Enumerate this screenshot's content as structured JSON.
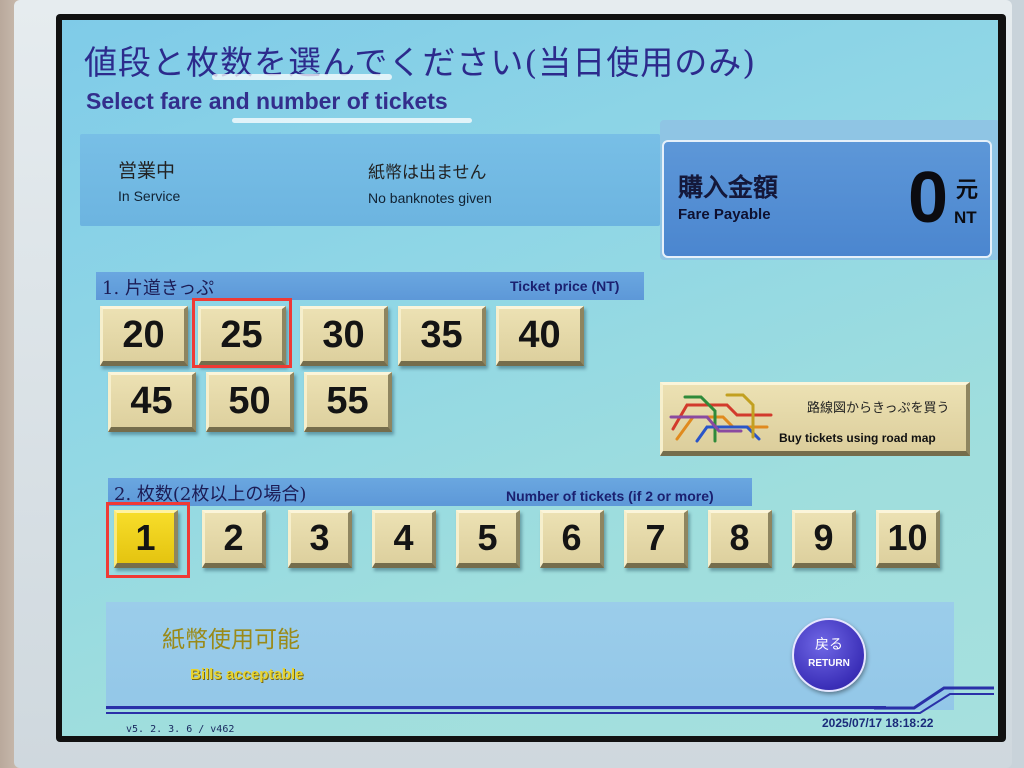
{
  "header": {
    "title_jp": "値段と枚数を選んでください(当日使用のみ)",
    "title_en": "Select fare and number of tickets"
  },
  "status": {
    "service_jp": "営業中",
    "service_en": "In Service",
    "notes_jp": "紙幣は出ません",
    "notes_en": "No banknotes given"
  },
  "fare": {
    "label_jp": "購入金額",
    "label_en": "Fare Payable",
    "amount": "0",
    "unit_jp": "元",
    "unit_en": "NT"
  },
  "ticket_price": {
    "section_jp": "1.  片道きっぷ",
    "section_en": "Ticket price (NT)",
    "options": [
      "20",
      "25",
      "30",
      "35",
      "40",
      "45",
      "50",
      "55"
    ],
    "highlighted": "25"
  },
  "route_map": {
    "label_jp": "路線図からきっぷを買う",
    "label_en": "Buy tickets using road map",
    "line_colors": [
      "#d23a2c",
      "#e08a1e",
      "#2f8a3a",
      "#2a55c8",
      "#c2a020",
      "#8a4aa0"
    ]
  },
  "ticket_count": {
    "section_jp": "2.  枚数(2枚以上の場合)",
    "section_en": "Number of tickets (if 2 or more)",
    "options": [
      "1",
      "2",
      "3",
      "4",
      "5",
      "6",
      "7",
      "8",
      "9",
      "10"
    ],
    "selected": "1"
  },
  "bottom": {
    "bills_jp": "紙幣使用可能",
    "bills_en": "Bills acceptable",
    "return_jp": "戻る",
    "return_en": "RETURN"
  },
  "footer": {
    "version": "v5. 2. 3. 6 / v462",
    "datetime": "2025/07/17  18:18:22"
  },
  "colors": {
    "title": "#2c2a8c",
    "key_face": "#e4d8a8",
    "key_selected": "#f0d21e",
    "highlight": "#ef3a35",
    "return_button": "#3b2fb8"
  }
}
